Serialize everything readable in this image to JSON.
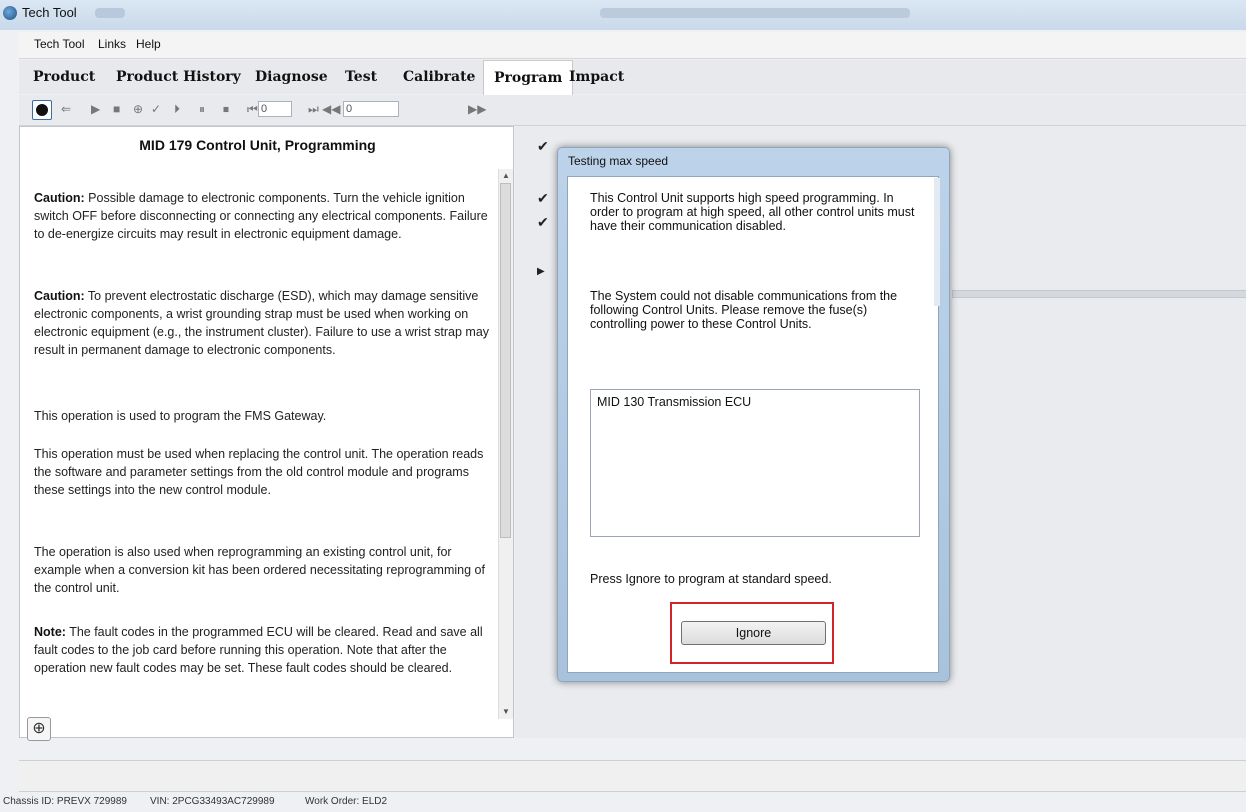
{
  "window": {
    "title": "Tech Tool"
  },
  "menu": [
    "Tech Tool",
    "Links",
    "Help"
  ],
  "tabs": [
    "Product",
    "Product History",
    "Diagnose",
    "Test",
    "Calibrate",
    "Program",
    "Impact"
  ],
  "active_tab": "Program",
  "toolbar": {
    "input1_value": "0",
    "input2_value": "0"
  },
  "document": {
    "title": "MID 179 Control Unit, Programming",
    "caution_label": "Caution:",
    "caution1": " Possible damage to electronic components. Turn the vehicle ignition switch OFF before disconnecting or connecting any electrical components. Failure to de-energize circuits may result in electronic equipment damage.",
    "caution2": " To prevent electrostatic discharge (ESD), which may damage sensitive electronic components, a wrist grounding strap must be used when working on electronic equipment (e.g., the instrument cluster). Failure to use a wrist strap may result in permanent damage to electronic components.",
    "p_program": "This operation is used to program the FMS Gateway.",
    "p_replace": "This operation must be used when replacing the control unit. The operation reads the software and parameter settings from the old control module and programs these settings into the new control module.",
    "p_reprogram": "The operation is also used when reprogramming an existing control unit, for example when a conversion kit has been ordered necessitating reprogramming of the control unit.",
    "note_label": "Note:",
    "note": " The fault codes in the programmed ECU will be cleared. Read and save all fault codes to the job card before running this operation. Note that after the operation new fault codes may be set. These fault codes should be cleared."
  },
  "dialog": {
    "title": "Testing max speed",
    "text1": "This Control Unit supports high speed programming. In order to program at high speed, all other control units must have their communication disabled.",
    "text2": "The System could not disable communications from the following Control Units. Please remove the fuse(s) controlling power to these Control Units.",
    "list_items": [
      "MID 130  Transmission ECU"
    ],
    "text3": "Press Ignore to program at standard speed.",
    "ignore_label": "Ignore"
  },
  "status": {
    "chassis": "Chassis ID: PREVX 729989",
    "vin": "VIN: 2PCG33493AC729989",
    "work_order": "Work Order: ELD2"
  },
  "colors": {
    "highlight": "#d2232a",
    "dialog_frame": "#a9c2dc"
  }
}
